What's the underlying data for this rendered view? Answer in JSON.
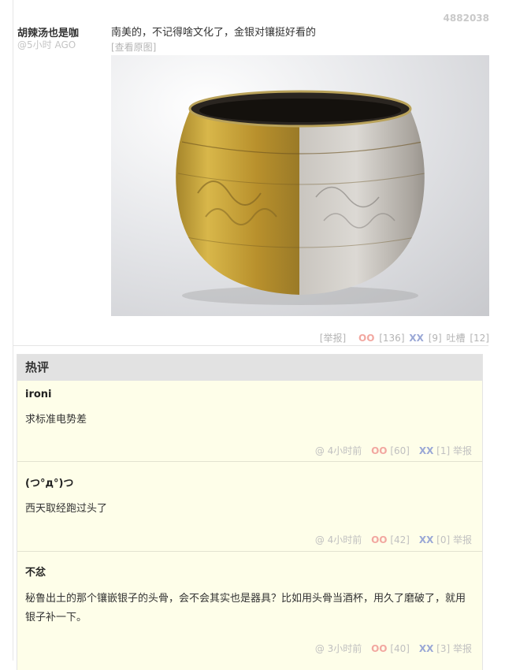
{
  "post": {
    "id": "4882038",
    "author": "胡辣汤也是咖",
    "time": "@5小时 AGO",
    "text": "南美的，不记得啥文化了，金银对镶挺好看的",
    "view_original": "[查看原图]",
    "report": "[举报]",
    "oo_label": "OO",
    "oo_count": "[136]",
    "xx_label": "XX",
    "xx_count": "[9]",
    "tucao_label": "吐槽",
    "tucao_count": "[12]"
  },
  "hot_comments": {
    "title": "热评",
    "comments": [
      {
        "author": "ironi",
        "text": "求标准电势差",
        "at": "@",
        "time": "4小时前",
        "oo_label": "OO",
        "oo_count": "[60]",
        "xx_label": "XX",
        "xx_count": "[1]",
        "report": "举报"
      },
      {
        "author": "(つ°д°)つ",
        "text": "西天取经跑过头了",
        "at": "@",
        "time": "4小时前",
        "oo_label": "OO",
        "oo_count": "[42]",
        "xx_label": "XX",
        "xx_count": "[0]",
        "report": "举报"
      },
      {
        "author": "不忿",
        "text": "秘鲁出土的那个镶嵌银子的头骨，会不会其实也是器具？比如用头骨当酒杯，用久了磨破了，就用银子补一下。",
        "at": "@",
        "time": "3小时前",
        "oo_label": "OO",
        "oo_count": "[40]",
        "xx_label": "XX",
        "xx_count": "[3]",
        "report": "举报"
      }
    ]
  },
  "colors": {
    "oo": "#f2a7a0",
    "xx": "#9aa8d6",
    "comment_bg": "#fefee9",
    "header_bg": "#e2e2e2"
  }
}
